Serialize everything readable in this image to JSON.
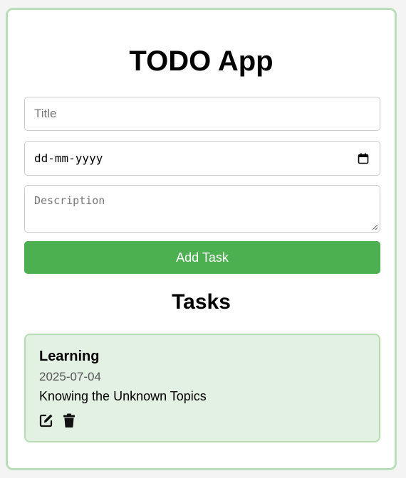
{
  "app": {
    "title": "TODO App"
  },
  "form": {
    "title_placeholder": "Title",
    "date_placeholder": "dd-mm-yyyy",
    "description_placeholder": "Description",
    "add_button_label": "Add Task"
  },
  "tasks": {
    "heading": "Tasks",
    "items": [
      {
        "title": "Learning",
        "date": "2025-07-04",
        "description": "Knowing the Unknown Topics",
        "actions": [
          "edit-icon",
          "trash-icon"
        ]
      }
    ]
  },
  "colors": {
    "accent": "#4caf50",
    "card_background": "#e3f1e3",
    "card_border": "#b5dcb5",
    "container_border": "#b9deb9"
  }
}
